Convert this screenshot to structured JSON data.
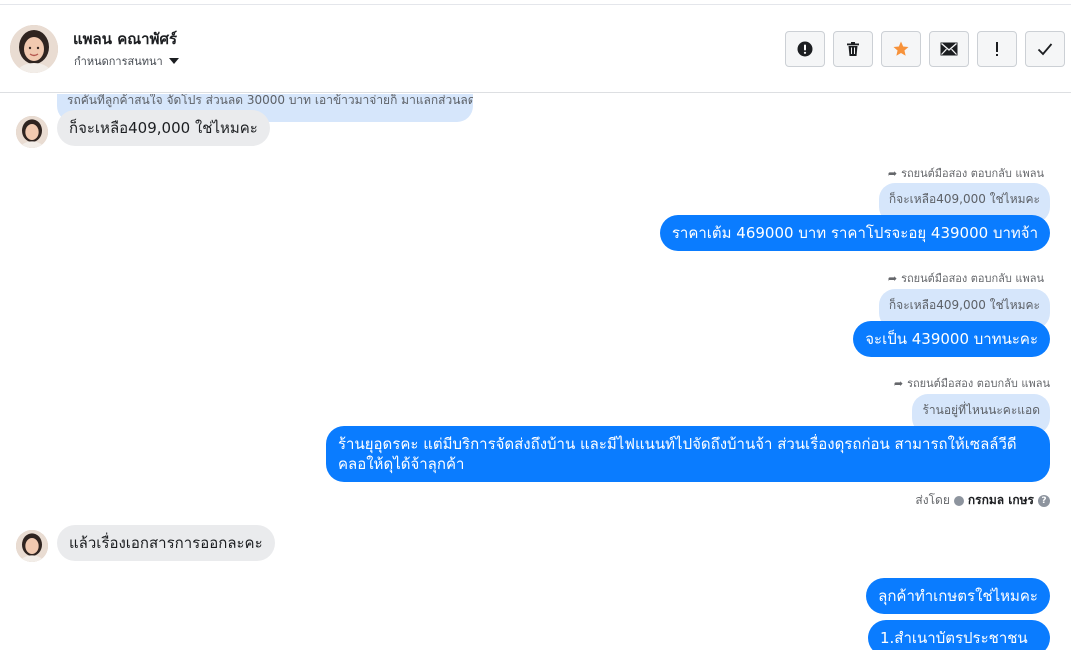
{
  "header": {
    "contact_name": "แพลน คณาพัศร์",
    "assign_label": "กำหนดการสนทนา",
    "actions": [
      {
        "name": "report-spam-button",
        "icon": "alert-circle-icon"
      },
      {
        "name": "delete-button",
        "icon": "trash-icon"
      },
      {
        "name": "star-button",
        "icon": "star-icon"
      },
      {
        "name": "mark-unread-button",
        "icon": "envelope-icon"
      },
      {
        "name": "follow-up-button",
        "icon": "exclamation-icon"
      },
      {
        "name": "mark-done-button",
        "icon": "checkmark-icon"
      }
    ]
  },
  "messages": {
    "partial_top": "รถคันที่ลูกค้าสนใจ จัดโปร ส่วนลด 30000 บาท เอาข้าวมาจ่ายก็ มาแลกส่วนลดจ้า",
    "m1": "ก็จะเหลือ409,000 ใช่ไหมคะ",
    "reply_meta_1": "รถยนต์มือสอง ตอบกลับ แพลน",
    "quote_1": "ก็จะเหลือ409,000 ใช่ไหมคะ",
    "m2": "ราคาเต้ม 469000 บาท ราคาโปรจะอยุ 439000 บาทจ้า",
    "reply_meta_2": "รถยนต์มือสอง ตอบกลับ แพลน",
    "quote_2": "ก็จะเหลือ409,000 ใช่ไหมคะ",
    "m3": "จะเป็น 439000 บาทนะคะ",
    "reply_meta_3": "รถยนต์มือสอง ตอบกลับ แพลน",
    "quote_3": "ร้านอยู่ที่ไหนนะคะแอด",
    "m4_line1": "ร้านยุอุดรคะ แต่มีบริการจัดส่งถึงบ้าน และมีไฟแนนท์ไปจัดถึงบ้านจ้า ส่วนเรื่องดุรถก่อน สามารถให้เซลล์วีดี",
    "m4_line2": "คลอให้ดุได้จ้าลุกค้า",
    "sent_by_label": "ส่งโดย",
    "sent_by_name": "กรกมล เกษร",
    "m5": "แล้วเรื่องเอกสารการออกละคะ",
    "m6": "ลุกค้าทำเกษตรใช่ไหมคะ",
    "m7": "1.สำเนาบัตรประชาชน"
  },
  "colors": {
    "outgoing": "#0a7cff",
    "incoming": "#eaebed",
    "quote": "#d6e6fb",
    "star": "#f7923a"
  }
}
